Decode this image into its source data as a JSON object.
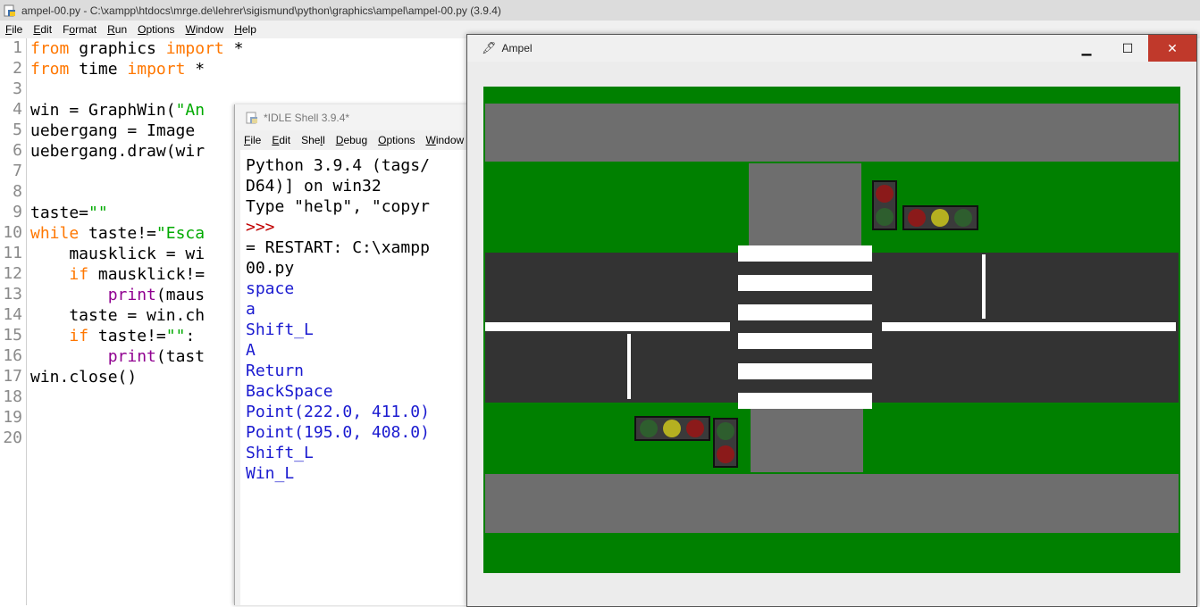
{
  "editor": {
    "title": "ampel-00.py - C:\\xampp\\htdocs\\mrge.de\\lehrer\\sigismund\\python\\graphics\\ampel\\ampel-00.py (3.9.4)",
    "menu": [
      {
        "pre": "",
        "ul": "F",
        "post": "ile"
      },
      {
        "pre": "",
        "ul": "E",
        "post": "dit"
      },
      {
        "pre": "F",
        "ul": "o",
        "post": "rmat"
      },
      {
        "pre": "",
        "ul": "R",
        "post": "un"
      },
      {
        "pre": "",
        "ul": "O",
        "post": "ptions"
      },
      {
        "pre": "",
        "ul": "W",
        "post": "indow"
      },
      {
        "pre": "",
        "ul": "H",
        "post": "elp"
      }
    ],
    "line_numbers": [
      "1",
      "2",
      "3",
      "4",
      "5",
      "6",
      "7",
      "8",
      "9",
      "10",
      "11",
      "12",
      "13",
      "14",
      "15",
      "16",
      "17",
      "18",
      "19",
      "20"
    ],
    "code": [
      [
        {
          "t": "from",
          "c": "kw"
        },
        {
          "t": " graphics ",
          "c": ""
        },
        {
          "t": "import",
          "c": "kw"
        },
        {
          "t": " *",
          "c": ""
        }
      ],
      [
        {
          "t": "from",
          "c": "kw"
        },
        {
          "t": " time ",
          "c": ""
        },
        {
          "t": "import",
          "c": "kw"
        },
        {
          "t": " *",
          "c": ""
        }
      ],
      [],
      [
        {
          "t": "win = GraphWin(",
          "c": ""
        },
        {
          "t": "\"An",
          "c": "str"
        }
      ],
      [
        {
          "t": "uebergang = Image",
          "c": ""
        }
      ],
      [
        {
          "t": "uebergang.draw(wir",
          "c": ""
        }
      ],
      [],
      [],
      [
        {
          "t": "taste=",
          "c": ""
        },
        {
          "t": "\"\"",
          "c": "str"
        }
      ],
      [
        {
          "t": "while",
          "c": "kw"
        },
        {
          "t": " taste!=",
          "c": ""
        },
        {
          "t": "\"Esca",
          "c": "str"
        }
      ],
      [
        {
          "t": "    mausklick = wi",
          "c": ""
        }
      ],
      [
        {
          "t": "    ",
          "c": ""
        },
        {
          "t": "if",
          "c": "kw"
        },
        {
          "t": " mausklick!=",
          "c": ""
        }
      ],
      [
        {
          "t": "        ",
          "c": ""
        },
        {
          "t": "print",
          "c": "bi"
        },
        {
          "t": "(maus",
          "c": ""
        }
      ],
      [
        {
          "t": "    taste = win.ch",
          "c": ""
        }
      ],
      [
        {
          "t": "    ",
          "c": ""
        },
        {
          "t": "if",
          "c": "kw"
        },
        {
          "t": " taste!=",
          "c": ""
        },
        {
          "t": "\"\"",
          "c": "str"
        },
        {
          "t": ":",
          "c": ""
        }
      ],
      [
        {
          "t": "        ",
          "c": ""
        },
        {
          "t": "print",
          "c": "bi"
        },
        {
          "t": "(tast",
          "c": ""
        }
      ],
      [
        {
          "t": "win.close()",
          "c": ""
        }
      ],
      [],
      [],
      []
    ]
  },
  "shell": {
    "title": "*IDLE Shell 3.9.4*",
    "menu": [
      {
        "pre": "",
        "ul": "F",
        "post": "ile"
      },
      {
        "pre": "",
        "ul": "E",
        "post": "dit"
      },
      {
        "pre": "She",
        "ul": "l",
        "post": "l"
      },
      {
        "pre": "",
        "ul": "D",
        "post": "ebug"
      },
      {
        "pre": "",
        "ul": "O",
        "post": "ptions"
      },
      {
        "pre": "",
        "ul": "W",
        "post": "indow"
      }
    ],
    "lines": [
      {
        "t": "Python 3.9.4 (tags/",
        "c": "c-out"
      },
      {
        "t": "D64)] on win32",
        "c": "c-out"
      },
      {
        "t": "Type \"help\", \"copyr",
        "c": "c-out"
      },
      {
        "t": ">>>",
        "c": "c-prompt"
      },
      {
        "t": "= RESTART: C:\\xampp",
        "c": "c-out"
      },
      {
        "t": "00.py",
        "c": "c-out"
      },
      {
        "t": "space",
        "c": "c-user"
      },
      {
        "t": "a",
        "c": "c-user"
      },
      {
        "t": "Shift_L",
        "c": "c-user"
      },
      {
        "t": "A",
        "c": "c-user"
      },
      {
        "t": "Return",
        "c": "c-user"
      },
      {
        "t": "BackSpace",
        "c": "c-user"
      },
      {
        "t": "Point(222.0, 411.0)",
        "c": "c-user"
      },
      {
        "t": "Point(195.0, 408.0)",
        "c": "c-user"
      },
      {
        "t": "Shift_L",
        "c": "c-user"
      },
      {
        "t": "Win_L",
        "c": "c-user"
      }
    ]
  },
  "ampel": {
    "title": "Ampel",
    "minimize_glyph": "▁",
    "maximize_glyph": "☐",
    "close_glyph": "✕",
    "colors": {
      "grass": "#008000",
      "sidewalk": "#6e6e6e",
      "road": "#333333",
      "marking": "#ffffff",
      "light_red": "#8b1a1a",
      "light_yellow": "#b5b020",
      "light_green": "#2e5e2e",
      "light_housing": "#3a3a3a"
    }
  }
}
